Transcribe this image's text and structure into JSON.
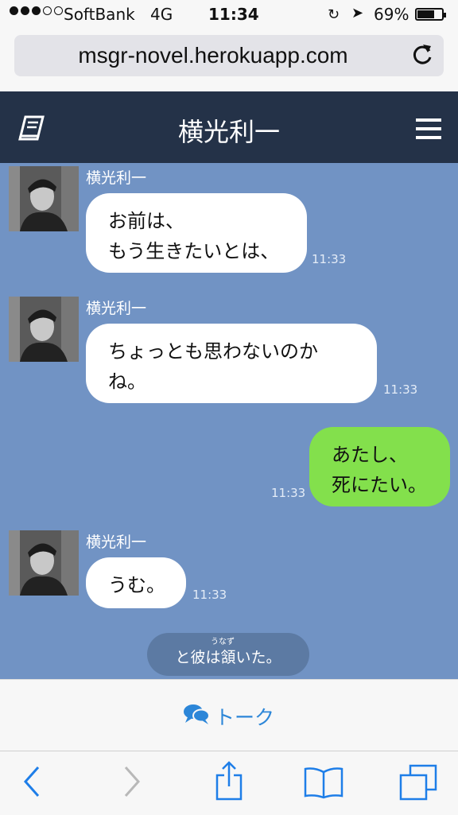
{
  "status_bar": {
    "carrier": "SoftBank",
    "network": "4G",
    "time": "11:34",
    "battery": "69%",
    "battery_level": 0.69
  },
  "browser": {
    "url": "msgr-novel.herokuapp.com"
  },
  "header": {
    "title": "横光利一"
  },
  "messages": [
    {
      "sender": "横光利一",
      "text": "お前は、\nもう生きたいとは、",
      "time": "11:33"
    },
    {
      "sender": "横光利一",
      "text": "ちょっとも思わないのか\nね。",
      "time": "11:33"
    },
    {
      "text": "あたし、\n死にたい。",
      "time": "11:33"
    },
    {
      "sender": "横光利一",
      "text": "うむ。",
      "time": "11:33"
    }
  ],
  "narration": {
    "ruby": "うなず",
    "text": "と彼は頷いた。"
  },
  "tab": {
    "label": "トーク"
  },
  "colors": {
    "header": "#243248",
    "chat_bg": "#7193c4",
    "my_bubble": "#83e04c",
    "accent": "#2c86d8"
  },
  "icons": [
    "book-icon",
    "menu-icon",
    "reload-icon",
    "chat-bubbles-icon",
    "back-icon",
    "forward-icon",
    "share-icon",
    "bookmarks-icon",
    "tabs-icon"
  ]
}
